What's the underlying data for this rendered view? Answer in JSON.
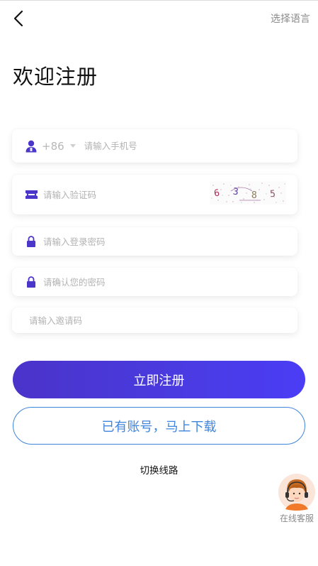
{
  "header": {
    "back_icon": "chevron-left-icon",
    "language_label": "选择语言"
  },
  "title": "欢迎注册",
  "form": {
    "phone": {
      "icon": "user-icon",
      "country_code": "+86",
      "placeholder": "请输入手机号"
    },
    "captcha": {
      "icon": "ticket-icon",
      "placeholder": "请输入验证码",
      "image_chars": [
        "6",
        "3",
        "8",
        "5"
      ]
    },
    "password": {
      "icon": "lock-icon",
      "placeholder": "请输入登录密码"
    },
    "confirm_password": {
      "icon": "lock-icon",
      "placeholder": "请确认您的密码"
    },
    "invite": {
      "placeholder": "请输入邀请码"
    }
  },
  "buttons": {
    "register": "立即注册",
    "have_account": "已有账号，马上下载"
  },
  "switch_line": "切换线路",
  "support": {
    "icon": "customer-service-avatar-icon",
    "label": "在线客服"
  },
  "colors": {
    "primary": "#4a3be0",
    "outline": "#3f84dd",
    "icon": "#4a36c8"
  }
}
